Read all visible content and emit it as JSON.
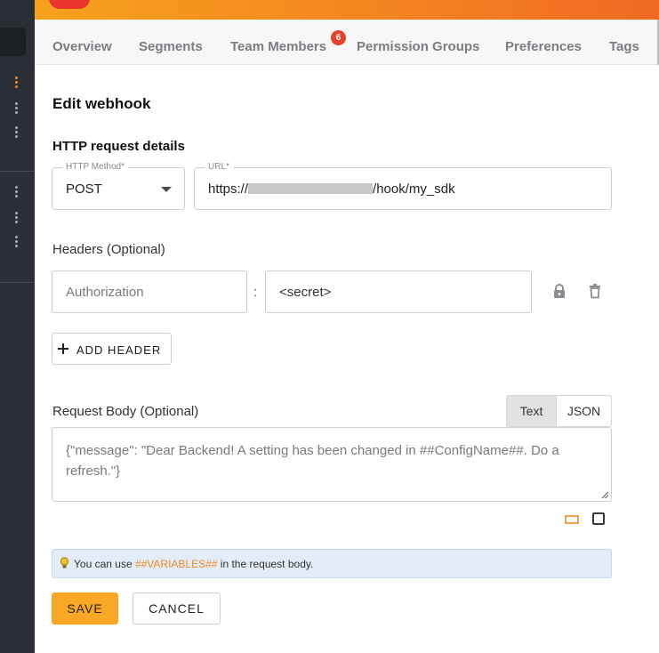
{
  "tabs": [
    {
      "label": "Overview"
    },
    {
      "label": "Segments"
    },
    {
      "label": "Team Members",
      "badge": "6"
    },
    {
      "label": "Permission Groups"
    },
    {
      "label": "Preferences"
    },
    {
      "label": "Tags"
    }
  ],
  "form": {
    "title": "Edit webhook",
    "section_title": "HTTP request details",
    "http_method": {
      "legend": "HTTP Method*",
      "value": "POST"
    },
    "url": {
      "legend": "URL*",
      "value_prefix": "https://",
      "value_suffix": "/hook/my_sdk"
    },
    "headers": {
      "label": "Headers (Optional)",
      "rows": [
        {
          "name": "Authorization",
          "separator": ":",
          "value": "<secret>"
        }
      ],
      "add_label": "ADD HEADER"
    },
    "body": {
      "label": "Request Body (Optional)",
      "toggle": [
        {
          "label": "Text",
          "selected": true
        },
        {
          "label": "JSON",
          "selected": false
        }
      ],
      "value": "{\"message\": \"Dear Backend! A setting has been changed in ##ConfigName##. Do a refresh.\"}"
    },
    "info": {
      "prefix": "You can use ",
      "highlight": "##VARIABLES##",
      "suffix": " in the request body."
    },
    "save_label": "SAVE",
    "cancel_label": "CANCEL"
  },
  "colors": {
    "accent": "#f9a825",
    "brand_orange": "#f58a20",
    "sidebar": "#2a2e35",
    "badge": "#e5412d",
    "info_bg": "#e3edf8"
  },
  "icons": [
    "kebab-menu-icon",
    "caret-down-icon",
    "lock-icon",
    "trash-icon",
    "plus-icon",
    "lightbulb-icon",
    "view-wide-icon",
    "view-square-icon",
    "resize-handle-icon"
  ]
}
